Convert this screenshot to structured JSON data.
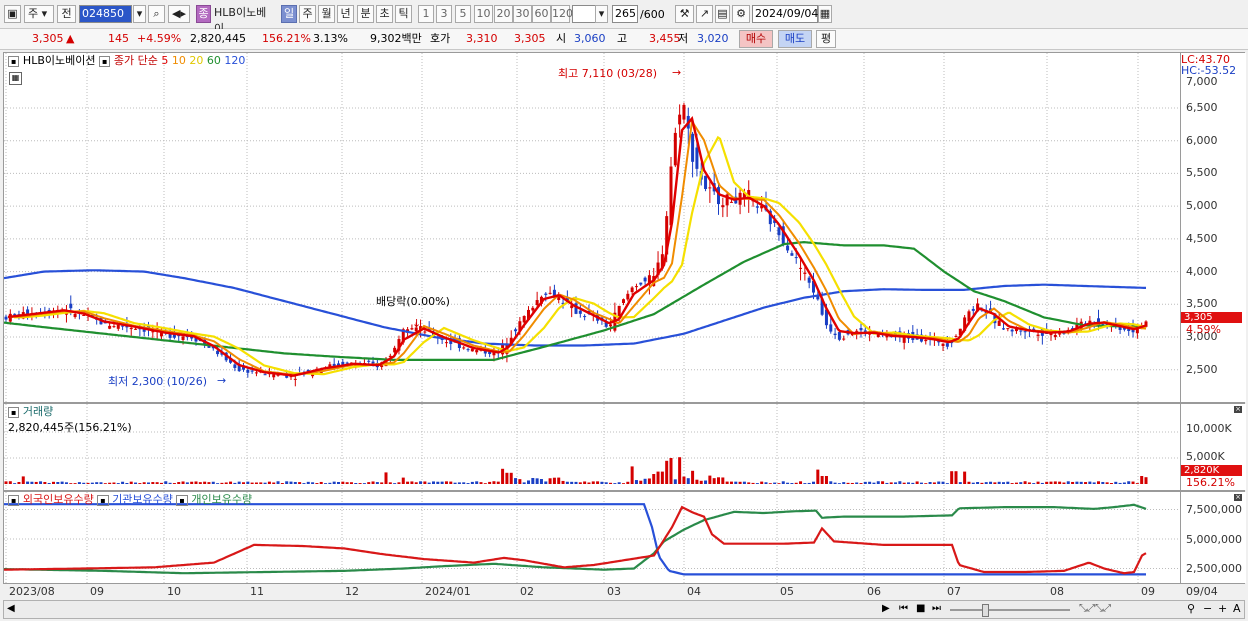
{
  "toolbar": {
    "market": "주",
    "prev": "전",
    "code": "024850",
    "badge": "종",
    "name": "HLB이노베이",
    "periods": [
      "일",
      "주",
      "월",
      "년",
      "분",
      "초",
      "틱"
    ],
    "active_period": "일",
    "minutes": [
      "1",
      "3",
      "5",
      "10",
      "20",
      "30",
      "60",
      "120"
    ],
    "count": "265",
    "max_count": "/600",
    "date": "2024/09/04"
  },
  "quote": {
    "price": "3,305",
    "change": "145",
    "change_pct": "+4.59%",
    "volume": "2,820,445",
    "volume_ratio": "156.21%",
    "turnover": "3.13%",
    "amount": "9,302백만",
    "hoga_label": "호가",
    "ask": "3,310",
    "bid": "3,305",
    "open_label": "시",
    "open": "3,060",
    "high_label": "고",
    "high": "3,455",
    "low_label": "저",
    "low": "3,020",
    "buy": "매수",
    "sell": "매도",
    "eval": "평"
  },
  "price_panel": {
    "title": "HLB이노베이션",
    "ma_title": "종가 단순",
    "ma_periods": [
      "5",
      "10",
      "20",
      "60",
      "120"
    ],
    "lc": "LC:43.70",
    "hc": "HC:-53.52",
    "high_note": "최고 7,110 (03/28)",
    "low_note": "최저 2,300 (10/26)",
    "dividend_note": "배당락(0.00%)",
    "current_price": "3,305",
    "current_pct": "4.59%",
    "y_ticks": [
      "6,500",
      "6,000",
      "5,500",
      "5,000",
      "4,500",
      "4,000",
      "3,500",
      "3,000",
      "2,500"
    ],
    "top_partial_tick": "7,000"
  },
  "volume_panel": {
    "title": "거래량",
    "value": "2,820,445주(156.21%)",
    "y_ticks": [
      "10,000K",
      "5,000K"
    ],
    "current": "2,820K",
    "current_pct": "156.21%"
  },
  "holding_panel": {
    "legend": [
      "외국인보유수량",
      "기관보유수량",
      "개인보유수량"
    ],
    "y_ticks": [
      "7,500,000",
      "5,000,000",
      "2,500,000"
    ]
  },
  "x_axis": [
    "2023/08",
    "09",
    "10",
    "11",
    "12",
    "2024/01",
    "02",
    "03",
    "04",
    "05",
    "06",
    "07",
    "08",
    "09"
  ],
  "x_axis_end": "09/04",
  "colors": {
    "ma5": "#e00000",
    "ma10": "#f08c00",
    "ma20": "#f5e000",
    "ma60": "#1f8f2f",
    "ma120": "#2850d8",
    "up": "#d40000",
    "down": "#1a3fc4"
  }
}
